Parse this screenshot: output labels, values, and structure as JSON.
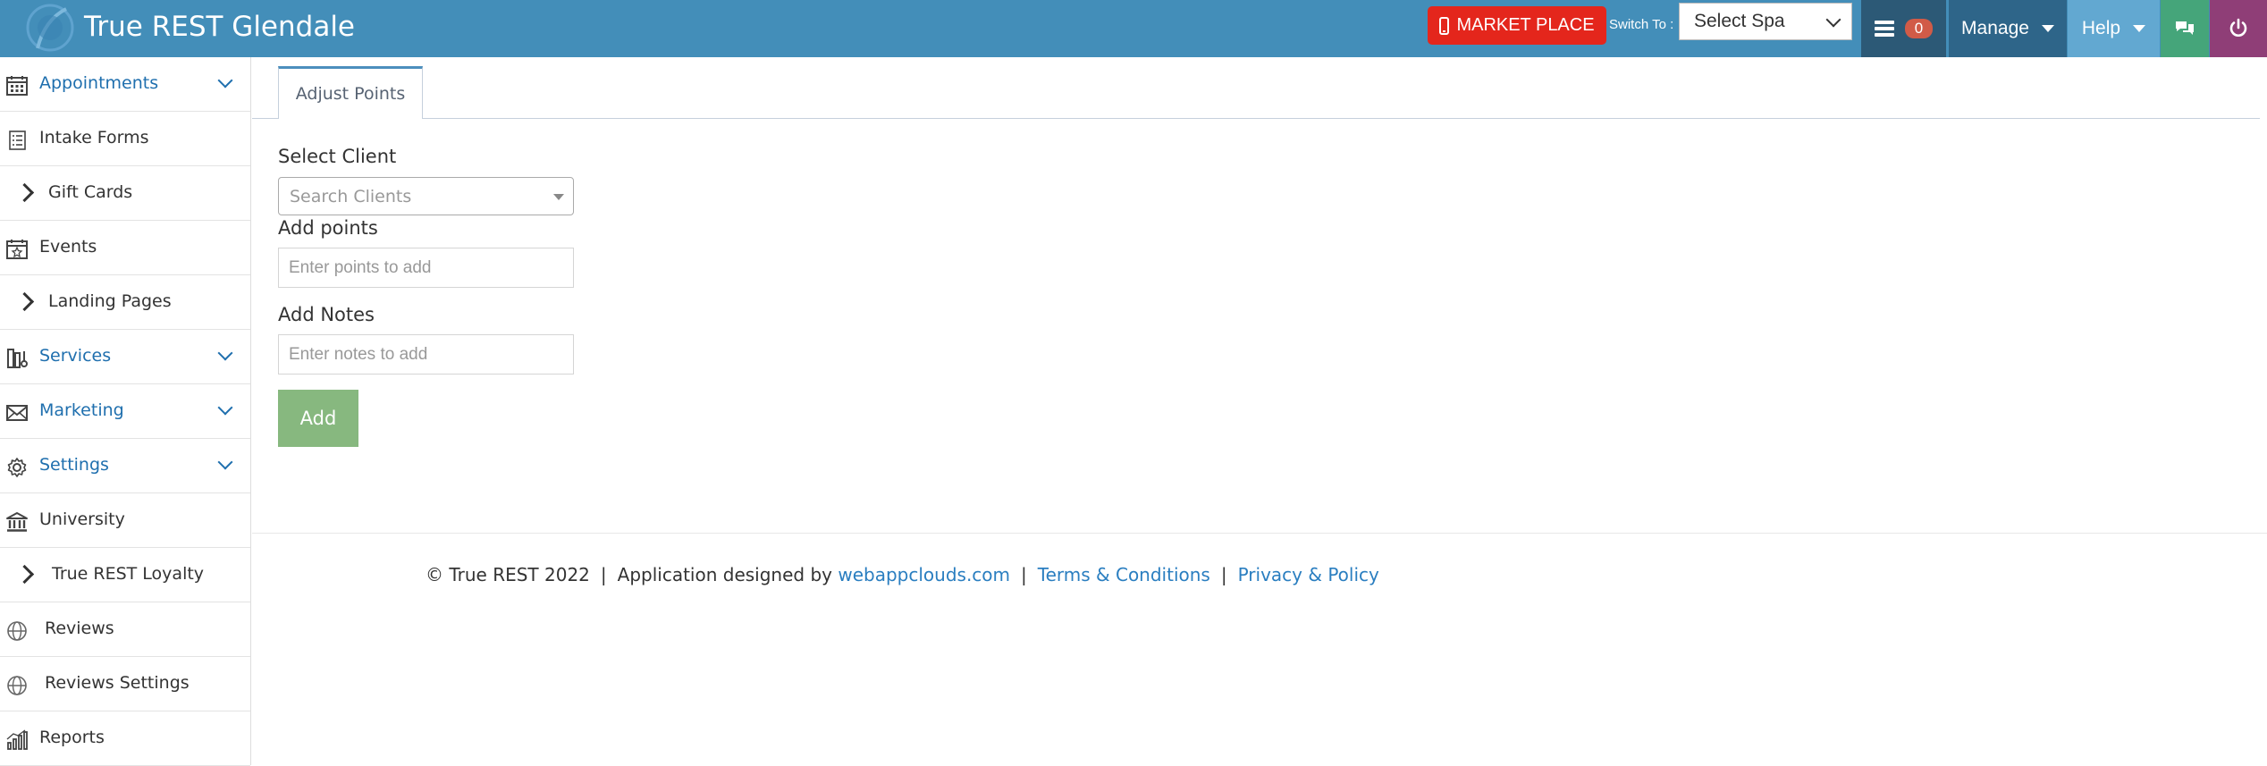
{
  "header": {
    "brand": "True REST Glendale",
    "market_place": "MARKET PLACE",
    "switch_to": "Switch To :",
    "spa_select": "Select Spa",
    "notification_count": "0",
    "manage": "Manage",
    "help": "Help"
  },
  "sidebar": {
    "items": [
      {
        "label": "Appointments",
        "icon": "calendar-icon"
      },
      {
        "label": "Intake Forms",
        "icon": "form-icon"
      },
      {
        "label": "Gift Cards",
        "icon": "chevron-right-icon"
      },
      {
        "label": "Events",
        "icon": "calendar-star-icon"
      },
      {
        "label": "Landing Pages",
        "icon": "chevron-right-icon"
      },
      {
        "label": "Services",
        "icon": "services-icon"
      },
      {
        "label": "Marketing",
        "icon": "envelope-icon"
      },
      {
        "label": "Settings",
        "icon": "gear-icon"
      },
      {
        "label": "University",
        "icon": "bank-icon"
      },
      {
        "label": "True REST Loyalty",
        "icon": "chevron-right-icon"
      },
      {
        "label": "Reviews",
        "icon": "globe-icon"
      },
      {
        "label": "Reviews Settings",
        "icon": "globe-icon"
      },
      {
        "label": "Reports",
        "icon": "bar-chart-icon"
      }
    ]
  },
  "main": {
    "tab": "Adjust Points",
    "select_client_label": "Select Client",
    "client_placeholder": "Search Clients",
    "add_points_label": "Add points",
    "points_placeholder": "Enter points to add",
    "add_notes_label": "Add Notes",
    "notes_placeholder": "Enter notes to add",
    "add_button": "Add"
  },
  "footer": {
    "copyright": "© True REST 2022",
    "designed_by": "Application designed by",
    "designer_link": "webappclouds.com",
    "separator": "|",
    "terms": "Terms & Conditions",
    "privacy": "Privacy & Policy"
  },
  "colors": {
    "topbar": "#438eb9",
    "market_place": "#e4261c",
    "manage": "#2e6589",
    "help": "#62a8d1",
    "chat": "#45a57a",
    "power": "#8f3e77",
    "add_button": "#87b87f",
    "link": "#2a7ec0"
  }
}
